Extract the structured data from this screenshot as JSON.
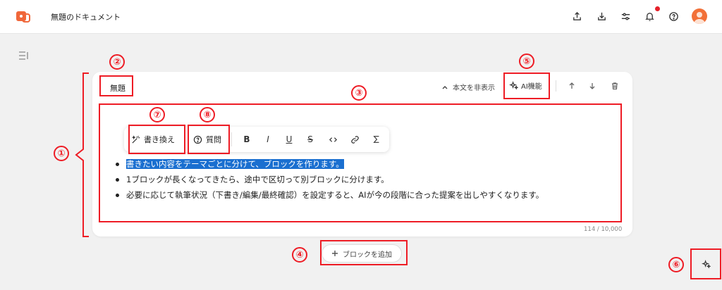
{
  "header": {
    "doc_title": "無題のドキュメント",
    "icons": [
      "share-icon",
      "download-icon",
      "settings-sliders-icon",
      "bell-icon",
      "help-icon"
    ],
    "avatar_color": "#f27038",
    "notification_color": "#e5202a"
  },
  "block": {
    "title": "無題",
    "hide_body_label": "本文を非表示",
    "ai_label": "AI機能",
    "counter": "114 / 10,000"
  },
  "toolbar": {
    "rewrite_label": "書き換え",
    "question_label": "質問",
    "format_buttons": [
      "B",
      "I",
      "U",
      "S"
    ]
  },
  "bullets": [
    "書きたい内容をテーマごとに分けて、ブロックを作ります。",
    "1ブロックが長くなってきたら、途中で区切って別ブロックに分けます。",
    "必要に応じて執筆状況（下書き/編集/最終確認）を設定すると、AIが今の段階に合った提案を出しやすくなります。"
  ],
  "add_block_label": "ブロックを追加",
  "annotations": [
    "①",
    "②",
    "③",
    "④",
    "⑤",
    "⑥",
    "⑦",
    "⑧"
  ],
  "colors": {
    "annotation": "#ee1c25",
    "selection": "#1a6fd0"
  }
}
